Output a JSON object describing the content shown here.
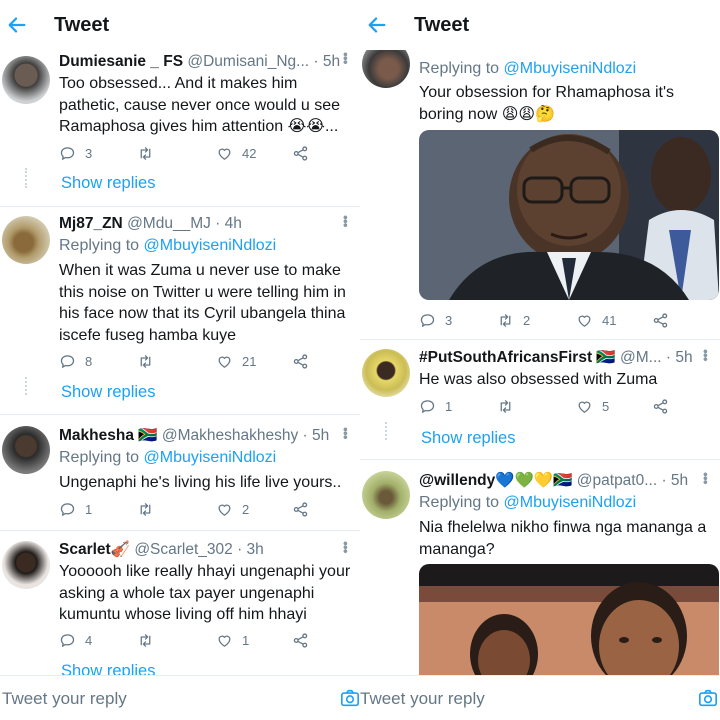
{
  "left": {
    "header": {
      "title": "Tweet"
    },
    "tweets": [
      {
        "name": "Dumiesanie _ FS",
        "handle": "@Dumisani_Ng...",
        "time": "· 5h",
        "text": "Too obsessed... And it makes him pathetic, cause never once would u see Ramaphosa gives him attention 😭😭...",
        "counts": {
          "reply": "3",
          "retweet": "",
          "like": "42"
        },
        "show_replies": "Show replies"
      },
      {
        "name": "Mj87_ZN",
        "handle": "@Mdu__MJ",
        "time": "· 4h",
        "replying_prefix": "Replying to",
        "replying_to": "@MbuyiseniNdlozi",
        "text": "When it was Zuma u never use to make this noise on Twitter u were telling him in his face now that its Cyril ubangela thina iscefe fuseg hamba kuye",
        "counts": {
          "reply": "8",
          "retweet": "",
          "like": "21"
        },
        "show_replies": "Show replies"
      },
      {
        "name": "Makhesha 🇿🇦",
        "handle": "@Makheshakheshy",
        "time": "· 5h",
        "replying_prefix": "Replying to",
        "replying_to": "@MbuyiseniNdlozi",
        "text": "Ungenaphi he's living his life live yours..",
        "counts": {
          "reply": "1",
          "retweet": "",
          "like": "2"
        }
      },
      {
        "name": "Scarlet🎻",
        "handle": "@Scarlet_302",
        "time": "· 3h",
        "text": "Yoooooh like really hhayi ungenaphi your asking a whole tax payer ungenaphi kumuntu whose living off him hhayi",
        "counts": {
          "reply": "4",
          "retweet": "",
          "like": "1"
        },
        "show_replies": "Show replies"
      }
    ],
    "footer": {
      "placeholder": "Tweet your reply"
    }
  },
  "right": {
    "header": {
      "title": "Tweet"
    },
    "tweets": [
      {
        "replying_prefix": "Replying to",
        "replying_to": "@MbuyiseniNdlozi",
        "text": "Your obsession for Rhamaphosa it's boring now 😩😩🤔",
        "counts": {
          "reply": "3",
          "retweet": "2",
          "like": "41"
        }
      },
      {
        "name": "#PutSouthAfricansFirst 🇿🇦",
        "handle": "@M...",
        "time": "· 5h",
        "text": "He was also obsessed with Zuma",
        "counts": {
          "reply": "1",
          "retweet": "",
          "like": "5"
        },
        "show_replies": "Show replies"
      },
      {
        "name": "@willendy💙💚💛🇿🇦",
        "handle": "@patpat0...",
        "time": "· 5h",
        "replying_prefix": "Replying to",
        "replying_to": "@MbuyiseniNdlozi",
        "text": "Nia fhelelwa nikho finwa nga mananga a mananga?",
        "counts": {
          "reply": "",
          "retweet": "",
          "like": ""
        }
      }
    ],
    "footer": {
      "placeholder": "Tweet your reply"
    }
  },
  "icons": {
    "back": "arrow-left-icon",
    "reply": "comment-icon",
    "retweet": "retweet-icon",
    "like": "heart-icon",
    "share": "share-icon",
    "more": "more-vertical-icon",
    "camera": "camera-icon"
  },
  "colors": {
    "accent": "#1da1f2",
    "secondary_text": "#657786",
    "divider": "#e6ecf0"
  }
}
